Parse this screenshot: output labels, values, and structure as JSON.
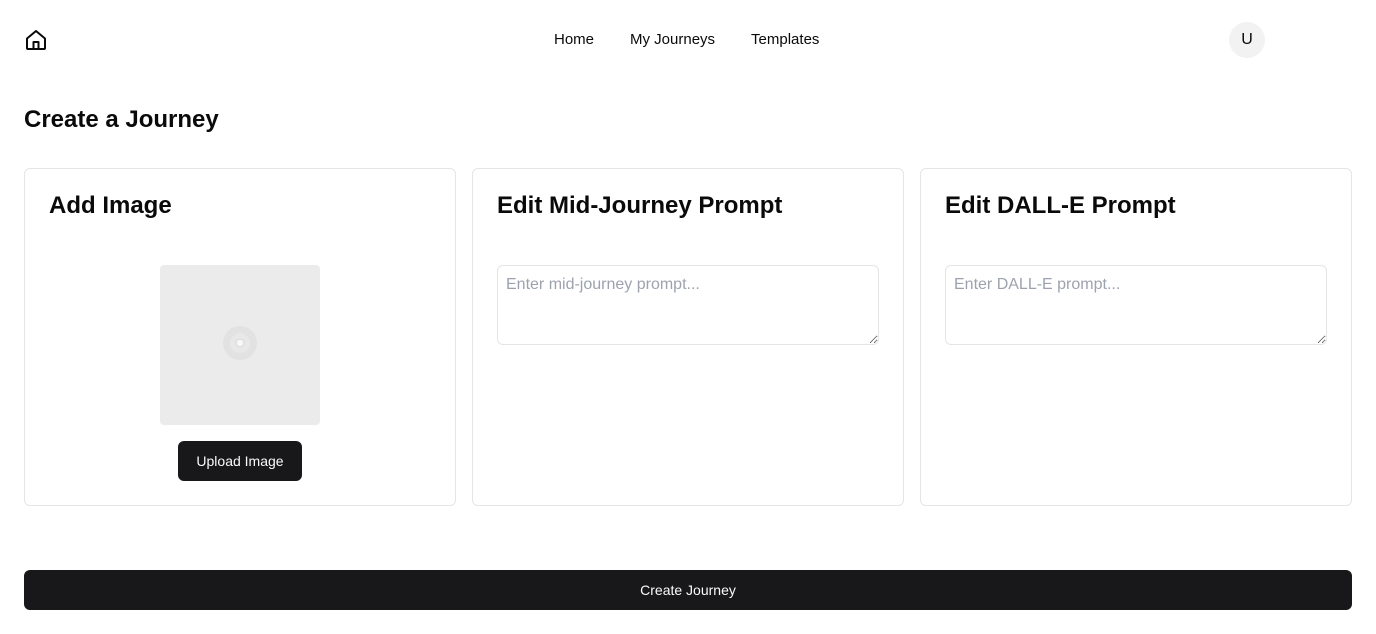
{
  "header": {
    "logo_icon": "home-icon",
    "nav": [
      {
        "label": "Home"
      },
      {
        "label": "My Journeys"
      },
      {
        "label": "Templates"
      }
    ],
    "avatar_initial": "U"
  },
  "page": {
    "title": "Create a Journey"
  },
  "cards": {
    "image": {
      "title": "Add Image",
      "placeholder_icon": "image-loading-icon",
      "upload_label": "Upload Image"
    },
    "midjourney": {
      "title": "Edit Mid-Journey Prompt",
      "value": "",
      "placeholder": "Enter mid-journey prompt..."
    },
    "dalle": {
      "title": "Edit DALL-E Prompt",
      "value": "",
      "placeholder": "Enter DALL-E prompt..."
    }
  },
  "actions": {
    "create_label": "Create Journey"
  },
  "colors": {
    "primary_button": "#18181b",
    "border": "#e5e5e5",
    "placeholder_bg": "#ebebeb"
  }
}
